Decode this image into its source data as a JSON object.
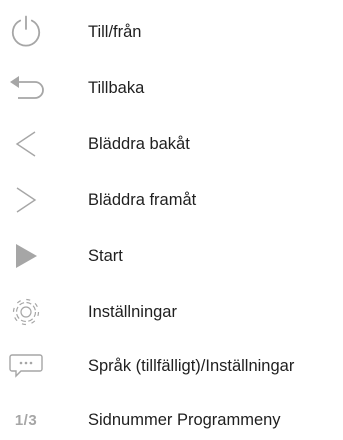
{
  "colors": {
    "icon": "#a6a6a6",
    "text": "#1f1f1f",
    "background": "#ffffff"
  },
  "legend": [
    {
      "icon": "power-icon",
      "label": "Till/från"
    },
    {
      "icon": "back-icon",
      "label": "Tillbaka"
    },
    {
      "icon": "chevron-left-icon",
      "label": "Bläddra bakåt"
    },
    {
      "icon": "chevron-right-icon",
      "label": "Bläddra framåt"
    },
    {
      "icon": "play-icon",
      "label": "Start"
    },
    {
      "icon": "gear-icon",
      "label": "Inställningar"
    },
    {
      "icon": "speech-bubble-icon",
      "label": "Språk (tillfälligt)/Inställningar"
    },
    {
      "icon": "page-number-icon",
      "icon_text": "1/3",
      "label": "Sidnummer Programmeny"
    }
  ]
}
